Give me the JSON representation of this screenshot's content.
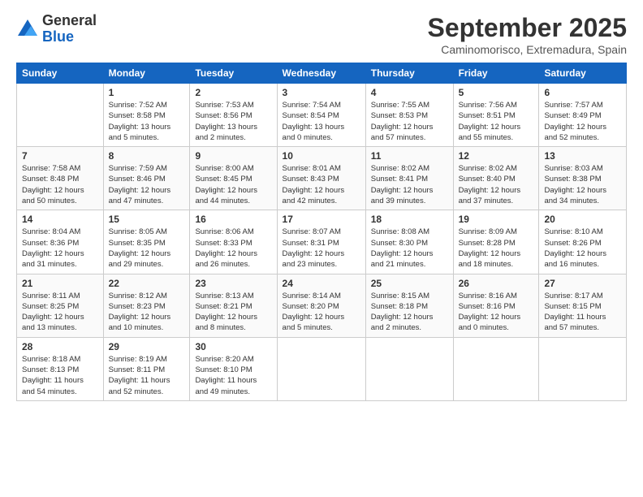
{
  "logo": {
    "general": "General",
    "blue": "Blue"
  },
  "header": {
    "title": "September 2025",
    "subtitle": "Caminomorisco, Extremadura, Spain"
  },
  "weekdays": [
    "Sunday",
    "Monday",
    "Tuesday",
    "Wednesday",
    "Thursday",
    "Friday",
    "Saturday"
  ],
  "weeks": [
    [
      {
        "num": "",
        "info": ""
      },
      {
        "num": "1",
        "info": "Sunrise: 7:52 AM\nSunset: 8:58 PM\nDaylight: 13 hours\nand 5 minutes."
      },
      {
        "num": "2",
        "info": "Sunrise: 7:53 AM\nSunset: 8:56 PM\nDaylight: 13 hours\nand 2 minutes."
      },
      {
        "num": "3",
        "info": "Sunrise: 7:54 AM\nSunset: 8:54 PM\nDaylight: 13 hours\nand 0 minutes."
      },
      {
        "num": "4",
        "info": "Sunrise: 7:55 AM\nSunset: 8:53 PM\nDaylight: 12 hours\nand 57 minutes."
      },
      {
        "num": "5",
        "info": "Sunrise: 7:56 AM\nSunset: 8:51 PM\nDaylight: 12 hours\nand 55 minutes."
      },
      {
        "num": "6",
        "info": "Sunrise: 7:57 AM\nSunset: 8:49 PM\nDaylight: 12 hours\nand 52 minutes."
      }
    ],
    [
      {
        "num": "7",
        "info": "Sunrise: 7:58 AM\nSunset: 8:48 PM\nDaylight: 12 hours\nand 50 minutes."
      },
      {
        "num": "8",
        "info": "Sunrise: 7:59 AM\nSunset: 8:46 PM\nDaylight: 12 hours\nand 47 minutes."
      },
      {
        "num": "9",
        "info": "Sunrise: 8:00 AM\nSunset: 8:45 PM\nDaylight: 12 hours\nand 44 minutes."
      },
      {
        "num": "10",
        "info": "Sunrise: 8:01 AM\nSunset: 8:43 PM\nDaylight: 12 hours\nand 42 minutes."
      },
      {
        "num": "11",
        "info": "Sunrise: 8:02 AM\nSunset: 8:41 PM\nDaylight: 12 hours\nand 39 minutes."
      },
      {
        "num": "12",
        "info": "Sunrise: 8:02 AM\nSunset: 8:40 PM\nDaylight: 12 hours\nand 37 minutes."
      },
      {
        "num": "13",
        "info": "Sunrise: 8:03 AM\nSunset: 8:38 PM\nDaylight: 12 hours\nand 34 minutes."
      }
    ],
    [
      {
        "num": "14",
        "info": "Sunrise: 8:04 AM\nSunset: 8:36 PM\nDaylight: 12 hours\nand 31 minutes."
      },
      {
        "num": "15",
        "info": "Sunrise: 8:05 AM\nSunset: 8:35 PM\nDaylight: 12 hours\nand 29 minutes."
      },
      {
        "num": "16",
        "info": "Sunrise: 8:06 AM\nSunset: 8:33 PM\nDaylight: 12 hours\nand 26 minutes."
      },
      {
        "num": "17",
        "info": "Sunrise: 8:07 AM\nSunset: 8:31 PM\nDaylight: 12 hours\nand 23 minutes."
      },
      {
        "num": "18",
        "info": "Sunrise: 8:08 AM\nSunset: 8:30 PM\nDaylight: 12 hours\nand 21 minutes."
      },
      {
        "num": "19",
        "info": "Sunrise: 8:09 AM\nSunset: 8:28 PM\nDaylight: 12 hours\nand 18 minutes."
      },
      {
        "num": "20",
        "info": "Sunrise: 8:10 AM\nSunset: 8:26 PM\nDaylight: 12 hours\nand 16 minutes."
      }
    ],
    [
      {
        "num": "21",
        "info": "Sunrise: 8:11 AM\nSunset: 8:25 PM\nDaylight: 12 hours\nand 13 minutes."
      },
      {
        "num": "22",
        "info": "Sunrise: 8:12 AM\nSunset: 8:23 PM\nDaylight: 12 hours\nand 10 minutes."
      },
      {
        "num": "23",
        "info": "Sunrise: 8:13 AM\nSunset: 8:21 PM\nDaylight: 12 hours\nand 8 minutes."
      },
      {
        "num": "24",
        "info": "Sunrise: 8:14 AM\nSunset: 8:20 PM\nDaylight: 12 hours\nand 5 minutes."
      },
      {
        "num": "25",
        "info": "Sunrise: 8:15 AM\nSunset: 8:18 PM\nDaylight: 12 hours\nand 2 minutes."
      },
      {
        "num": "26",
        "info": "Sunrise: 8:16 AM\nSunset: 8:16 PM\nDaylight: 12 hours\nand 0 minutes."
      },
      {
        "num": "27",
        "info": "Sunrise: 8:17 AM\nSunset: 8:15 PM\nDaylight: 11 hours\nand 57 minutes."
      }
    ],
    [
      {
        "num": "28",
        "info": "Sunrise: 8:18 AM\nSunset: 8:13 PM\nDaylight: 11 hours\nand 54 minutes."
      },
      {
        "num": "29",
        "info": "Sunrise: 8:19 AM\nSunset: 8:11 PM\nDaylight: 11 hours\nand 52 minutes."
      },
      {
        "num": "30",
        "info": "Sunrise: 8:20 AM\nSunset: 8:10 PM\nDaylight: 11 hours\nand 49 minutes."
      },
      {
        "num": "",
        "info": ""
      },
      {
        "num": "",
        "info": ""
      },
      {
        "num": "",
        "info": ""
      },
      {
        "num": "",
        "info": ""
      }
    ]
  ]
}
